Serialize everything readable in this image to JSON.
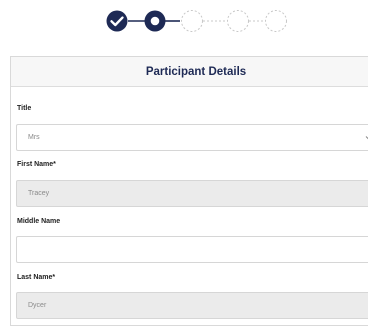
{
  "stepper": {
    "steps": [
      {
        "state": "completed",
        "icon": "check-icon"
      },
      {
        "state": "current",
        "icon": "dot-icon"
      },
      {
        "state": "pending"
      },
      {
        "state": "pending"
      },
      {
        "state": "pending"
      }
    ],
    "colors": {
      "primary": "#1e2a55",
      "pending": "#c8c8c8"
    }
  },
  "form": {
    "title": "Participant Details",
    "fields": {
      "title": {
        "label": "Title",
        "value": "Mrs"
      },
      "first_name": {
        "label": "First Name*",
        "value": "Tracey"
      },
      "middle_name": {
        "label": "Middle Name",
        "value": ""
      },
      "last_name": {
        "label": "Last Name*",
        "value": "Dycer"
      }
    }
  }
}
